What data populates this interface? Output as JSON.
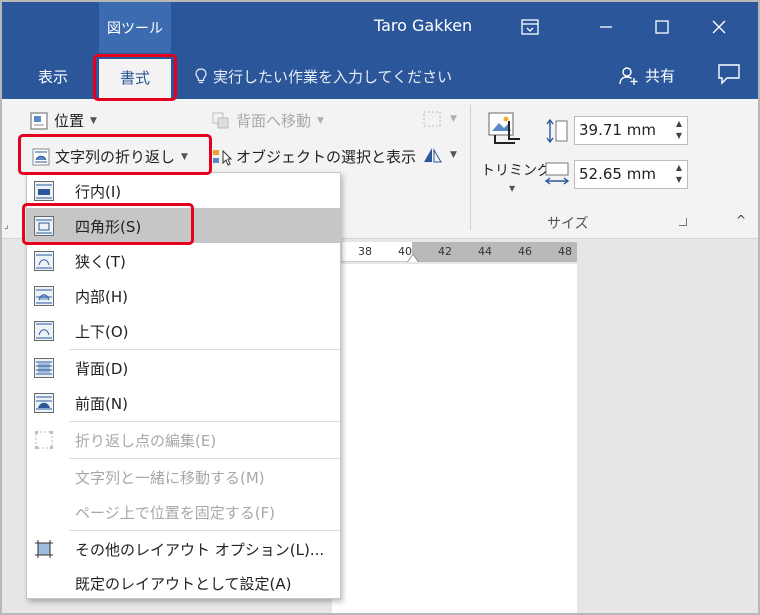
{
  "titlebar": {
    "context_tab": "図ツール",
    "title": "Taro Gakken"
  },
  "tabs": {
    "view": "表示",
    "format": "書式",
    "tell_me": "実行したい作業を入力してください",
    "share": "共有"
  },
  "ribbon": {
    "position": "位置",
    "send_backward": "背面へ移動",
    "wrap_text": "文字列の折り返し",
    "selection_pane": "オブジェクトの選択と表示",
    "crop": "トリミング",
    "height": "39.71 mm",
    "width": "52.65 mm",
    "size_group": "サイズ"
  },
  "ruler": {
    "ticks": [
      "38",
      "40",
      "42",
      "44",
      "46",
      "48"
    ]
  },
  "menu": {
    "items": [
      {
        "label": "行内(I)",
        "icon": "wrap-inline-icon"
      },
      {
        "label": "四角形(S)",
        "icon": "wrap-square-icon",
        "selected": true
      },
      {
        "label": "狭く(T)",
        "icon": "wrap-tight-icon"
      },
      {
        "label": "内部(H)",
        "icon": "wrap-through-icon"
      },
      {
        "label": "上下(O)",
        "icon": "wrap-top-bottom-icon"
      },
      {
        "label": "背面(D)",
        "icon": "wrap-behind-icon"
      },
      {
        "label": "前面(N)",
        "icon": "wrap-front-icon"
      },
      {
        "label": "折り返し点の編集(E)",
        "icon": "edit-wrap-points-icon",
        "disabled": true
      },
      {
        "label": "文字列と一緒に移動する(M)",
        "disabled": true
      },
      {
        "label": "ページ上で位置を固定する(F)",
        "disabled": true
      },
      {
        "label": "その他のレイアウト オプション(L)...",
        "icon": "layout-options-icon"
      },
      {
        "label": "既定のレイアウトとして設定(A)"
      }
    ]
  },
  "colors": {
    "accent": "#2b579a",
    "highlight": "#e5001e",
    "selected_item": "#c6c6c6"
  }
}
